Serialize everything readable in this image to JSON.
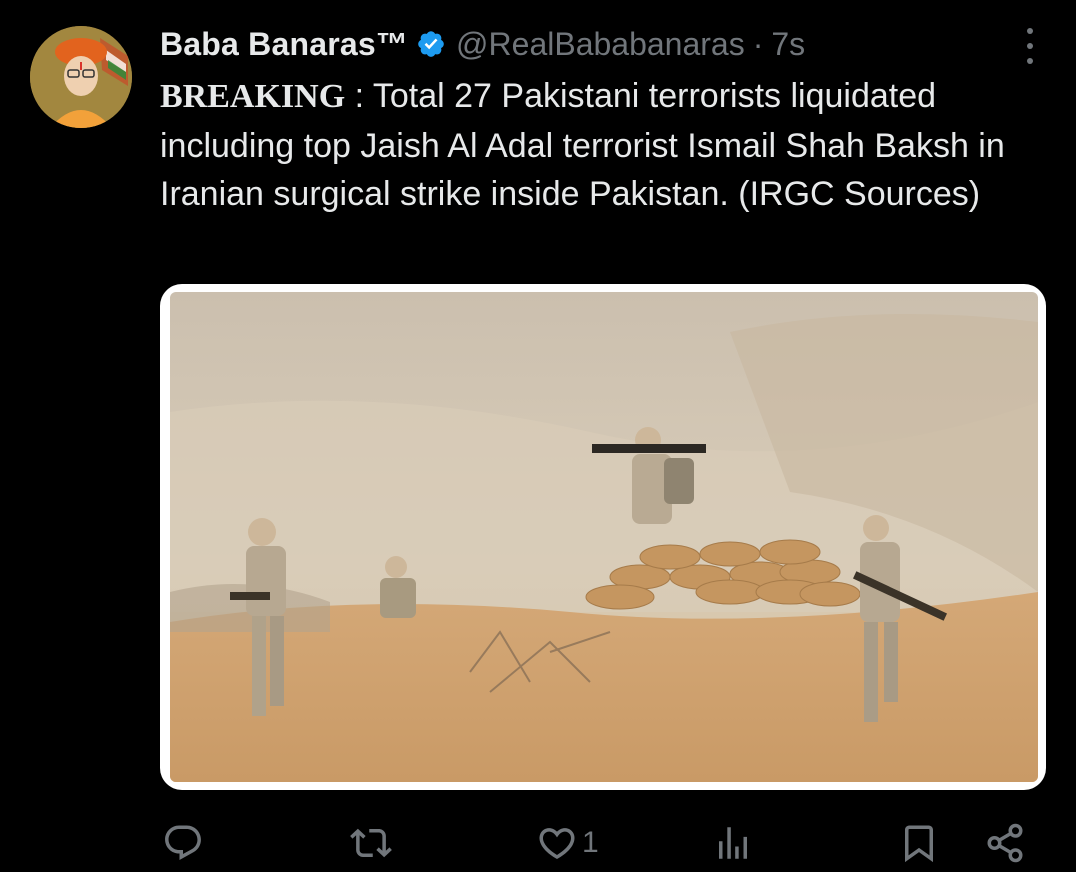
{
  "user": {
    "display_name": "Baba Banaras™",
    "handle": "@RealBababanaras",
    "separator": "·",
    "time": "7s",
    "verified": true,
    "verified_color": "#1d9bf0"
  },
  "tweet": {
    "breaking_label": "BREAKING",
    "body": " : Total 27 Pakistani terrorists liquidated including top Jaish Al Adal terrorist Ismail Shah Baksh in Iranian surgical strike inside Pakistan. (IRGC Sources)"
  },
  "media": {
    "icon": "photo-soldiers-desert"
  },
  "actions": {
    "reply": {
      "icon": "reply-icon",
      "count": ""
    },
    "retweet": {
      "icon": "retweet-icon",
      "count": ""
    },
    "like": {
      "icon": "heart-icon",
      "count": "1"
    },
    "views": {
      "icon": "views-icon",
      "count": ""
    },
    "bookmark": {
      "icon": "bookmark-icon"
    },
    "share": {
      "icon": "share-icon"
    }
  },
  "colors": {
    "background": "#000000",
    "text": "#e7e9ea",
    "secondary": "#71767b",
    "accent": "#1d9bf0"
  }
}
